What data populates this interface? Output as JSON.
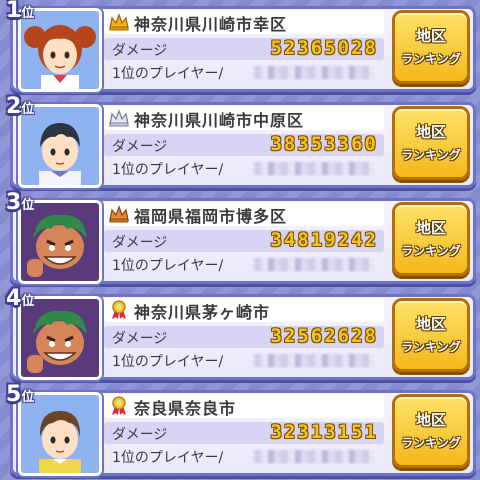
{
  "ranking": {
    "damage_label": "ダメージ",
    "player_label": "1位のプレイヤー/",
    "button_line1": "地区",
    "button_line2": "ランキング",
    "rank_suffix": "位",
    "entries": [
      {
        "rank": "1",
        "badge": "gold-crown",
        "region": "神奈川県川崎市幸区",
        "damage": "52365028",
        "avatar": "girl-red-hair"
      },
      {
        "rank": "2",
        "badge": "silver-crown",
        "region": "神奈川県川崎市中原区",
        "damage": "38353360",
        "avatar": "boy-dark-hair"
      },
      {
        "rank": "3",
        "badge": "bronze-crown",
        "region": "福岡県福岡市博多区",
        "damage": "34819242",
        "avatar": "green-hair-grin"
      },
      {
        "rank": "4",
        "badge": "red-ribbon-medal",
        "region": "神奈川県茅ヶ崎市",
        "damage": "32562628",
        "avatar": "green-hair-grin"
      },
      {
        "rank": "5",
        "badge": "red-ribbon-medal",
        "region": "奈良県奈良市",
        "damage": "32313151",
        "avatar": "boy-brown-hair"
      }
    ]
  },
  "colors": {
    "background": "#8a8fd4",
    "gold": "#f5c518",
    "button": "#f3b81c"
  }
}
